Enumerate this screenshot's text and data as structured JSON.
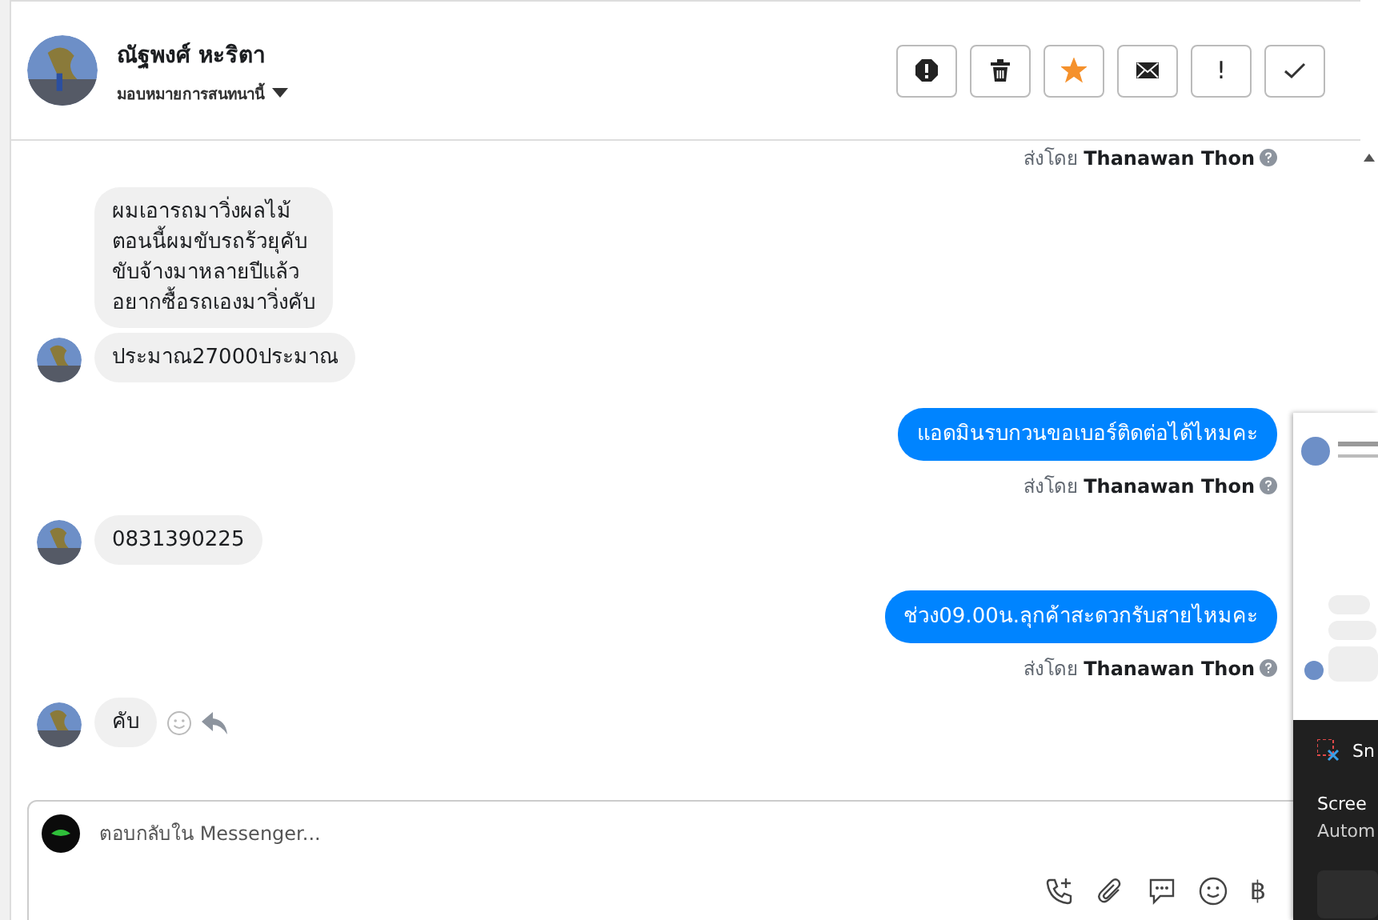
{
  "contact": {
    "name": "ณัฐพงศ์ หะริตา",
    "assign": "มอบหมายการสนทนานี้"
  },
  "actions": [
    {
      "kind": "alert"
    },
    {
      "kind": "trash"
    },
    {
      "kind": "star",
      "on": true
    },
    {
      "kind": "mail"
    },
    {
      "kind": "text",
      "label": "!"
    },
    {
      "kind": "check"
    }
  ],
  "messages": [
    {
      "kind": "sender",
      "text": "ส่งโดย **Thanawan Thon**"
    },
    {
      "kind": "in",
      "texts": [
        "ผมเอารถมาวิ่งผลไม้\nตอนนี้ผมขับรถร้วยุคับ\nขับจ้างมาหลายปีแล้ว\nอยากซื้อรถเองมาวิ่งคับ",
        "ประมาณ27000ประมาณ"
      ]
    },
    {
      "kind": "out",
      "texts": [
        "แอดมินรบกวนขอเบอร์ติดต่อได้ไหมคะ"
      ]
    },
    {
      "kind": "sender",
      "text": "ส่งโดย **Thanawan Thon**"
    },
    {
      "kind": "in",
      "texts": [
        "0831390225"
      ]
    },
    {
      "kind": "out",
      "texts": [
        "ช่วง09.00น.ลุกค้าสะดวกรับสายไหมคะ"
      ]
    },
    {
      "kind": "sender",
      "text": "ส่งโดย **Thanawan Thon**"
    },
    {
      "kind": "in",
      "texts": [
        "คับ"
      ],
      "reactions": true
    }
  ],
  "composer": {
    "placeholder": "ตอบกลับใน Messenger...",
    "currency": "฿"
  },
  "notification": {
    "app": "Sn",
    "title": "Scree",
    "body": "Autom"
  }
}
